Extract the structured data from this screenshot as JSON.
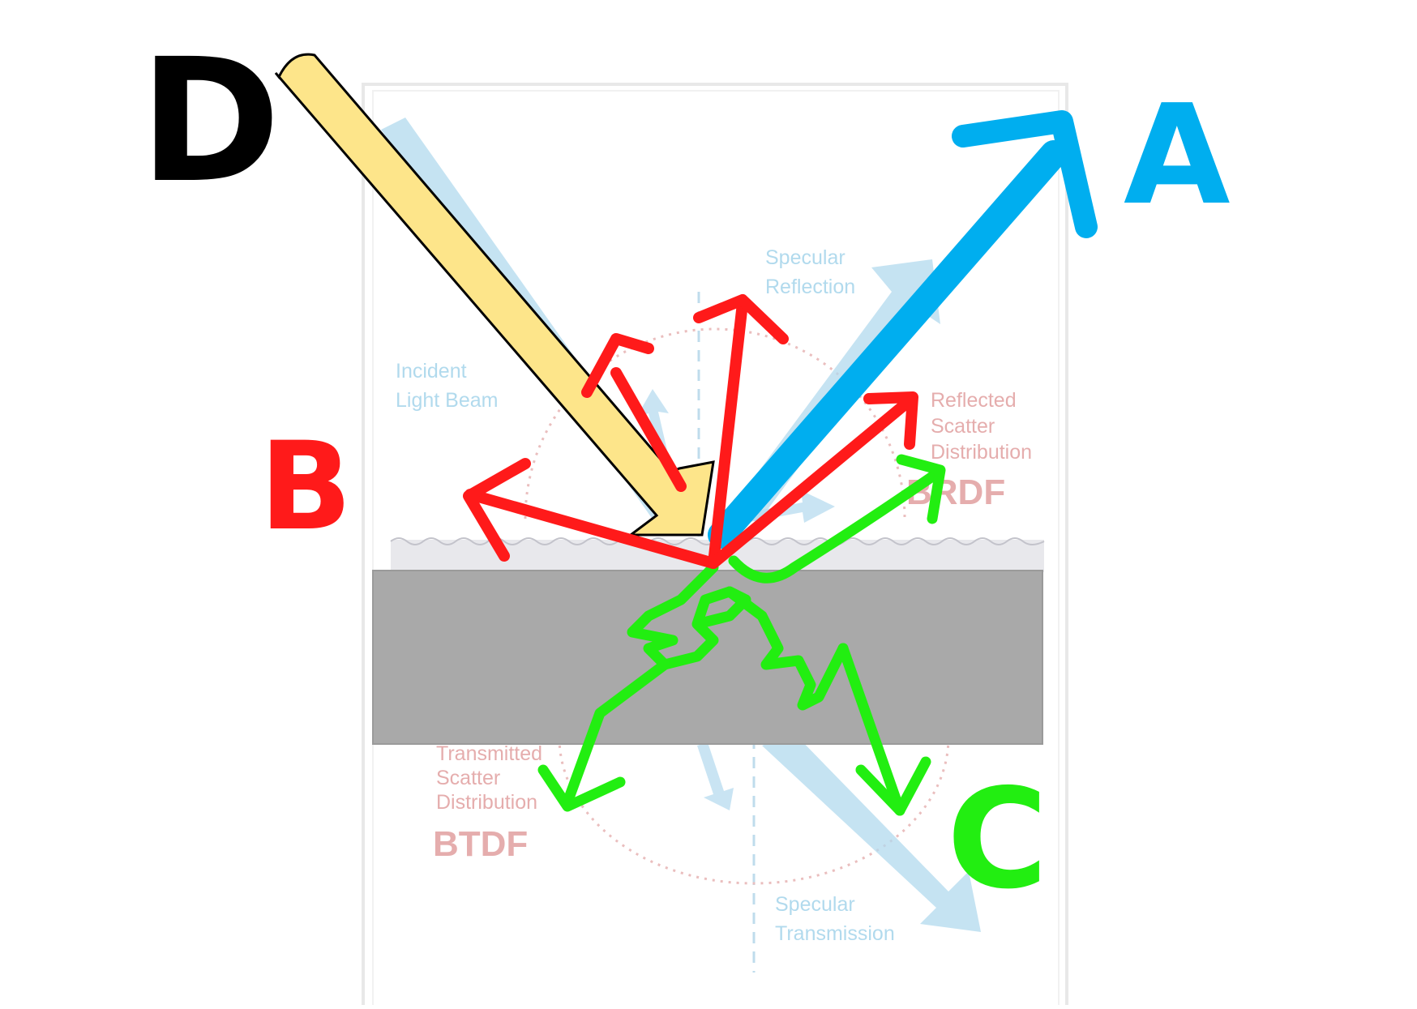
{
  "background_figure": {
    "labels": {
      "specular_reflection": [
        "Specular",
        "Reflection"
      ],
      "incident_light_beam": [
        "Incident",
        "Light Beam"
      ],
      "reflected_scatter": [
        "Reflected",
        "Scatter",
        "Distribution"
      ],
      "brdf": "BRDF",
      "transmitted_scatter": [
        "Transmitted",
        "Scatter",
        "Distribution"
      ],
      "btdf": "BTDF",
      "specular_transmission": [
        "Specular",
        "Transmission"
      ]
    }
  },
  "annotations": {
    "label_a": "A",
    "label_b": "B",
    "label_c": "C",
    "label_d": "D"
  },
  "colors": {
    "incident_arrow": "#fde58a",
    "specular_arrow": "#00aeef",
    "scatter_reflection_arrows": "#ff1a1a",
    "transmission_arrows": "#22ee11",
    "sample_slab": "#a9a9a9",
    "ink": "#000000"
  }
}
